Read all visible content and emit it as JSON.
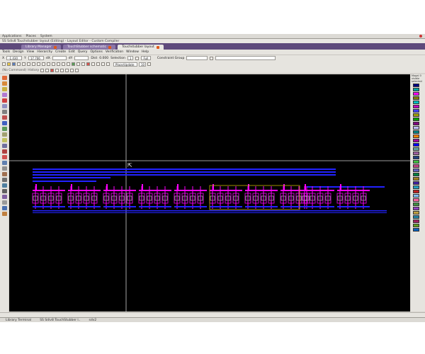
{
  "panel": {
    "items": [
      "Applications",
      "Places",
      "System"
    ]
  },
  "window": {
    "title": "SS Sdiv8 Touchstubber layout (Editing) - Layout Editor - Custom Compiler"
  },
  "tabs": [
    {
      "label": "Library Manager",
      "active": false
    },
    {
      "label": "TouchStubber schematic",
      "active": false
    },
    {
      "label": "Touchstubber layout",
      "active": true
    }
  ],
  "menu": [
    "Tools",
    "Design",
    "View",
    "Hierarchy",
    "Create",
    "Edit",
    "Query",
    "Options",
    "Verification",
    "Window",
    "Help"
  ],
  "toolbar": {
    "x_label": "X",
    "x_value": "-1.430",
    "y_label": "Y",
    "y_value": "17.706",
    "dx_label": "dX",
    "dy_label": "dY",
    "dist_label": "Dist",
    "dist_value": "0.000",
    "selection_label": "Selection",
    "selection_value": "1",
    "full_label": "Full",
    "constraint_label": "Constraint Group",
    "place_mode": "Place/Update",
    "zoom_field": "10"
  },
  "command": {
    "label": "(No Command)",
    "history_label": "History"
  },
  "right_panel": {
    "labels": [
      "Mogal 0",
      "visible",
      "selected"
    ]
  },
  "taskbar": {
    "items": [
      "Library Terminal",
      "SS Sdiv8 TouchStubber l..",
      "sdv2"
    ]
  },
  "colors": {
    "canvas": "#000000",
    "metal1": "#2222ff",
    "poly": "#ff00ff",
    "diff": "#ffffff",
    "selection": "#c8b400",
    "crosshair": "#d0d0d0",
    "tabbar": "#5e4a7c"
  }
}
